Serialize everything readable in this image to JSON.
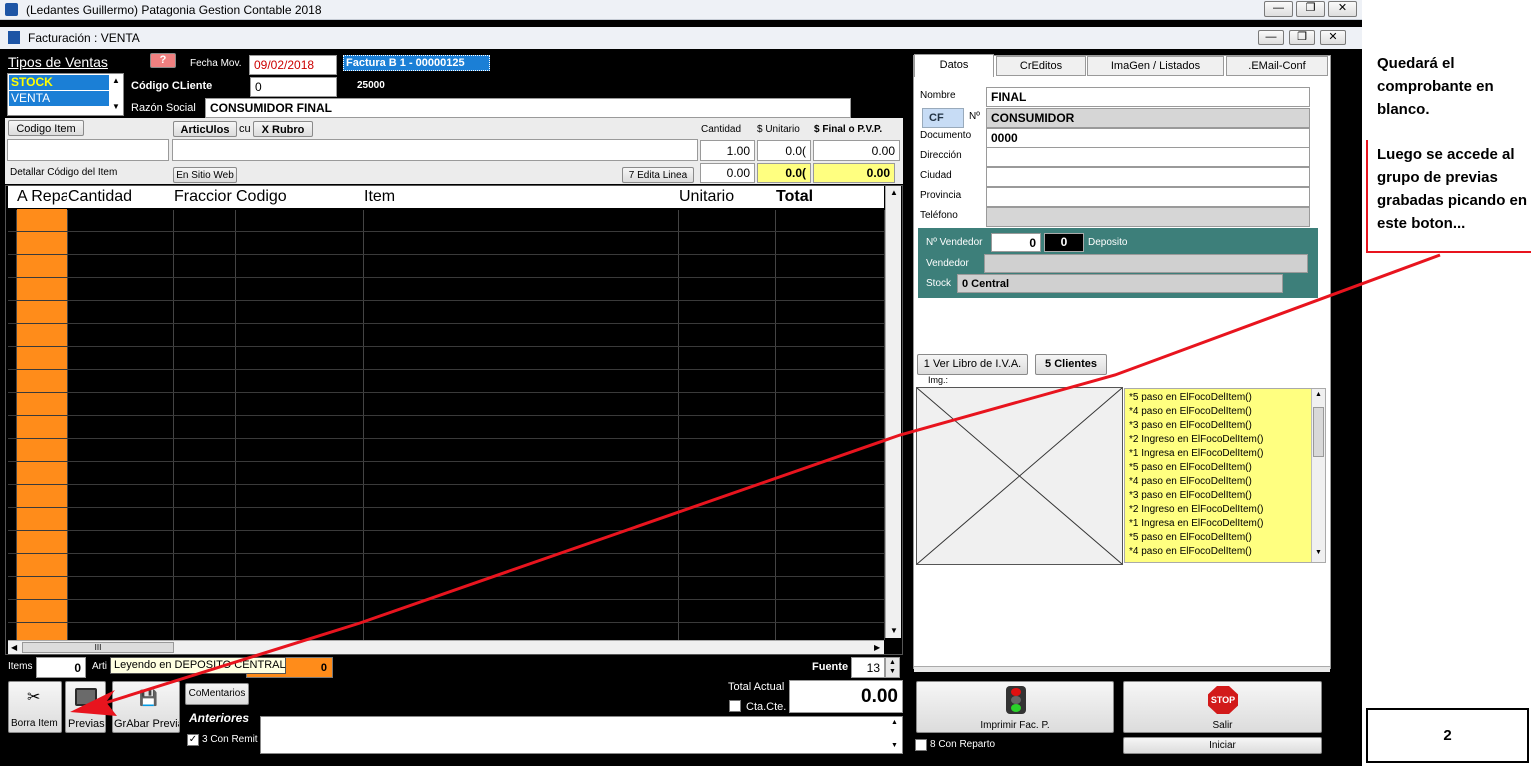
{
  "app": {
    "window_title": "(Ledantes Guillermo) Patagonia Gestion Contable 2018",
    "child_title": "Facturación : VENTA",
    "minimize_icon": "minimize-icon",
    "maximize_icon": "restore-icon",
    "close_icon": "close-icon"
  },
  "left": {
    "tipos_ventas_label": "Tipos de Ventas",
    "tipos_ventas_items": [
      "STOCK",
      "VENTA"
    ],
    "help_button": "?",
    "fecha_mov_label": "Fecha Mov.",
    "fecha_mov_value": "09/02/2018",
    "factura_label": "Factura  B   1 - 00000125",
    "codigo_cliente_label": "Código CLiente",
    "codigo_cliente_value": "0",
    "codigo_cliente_extra": "25000",
    "razon_social_label": "Razón Social",
    "razon_social_value": "CONSUMIDOR FINAL",
    "codigo_item_button": "Codigo Item",
    "articulos_button": "ArticUlos",
    "articulos_suffix": "cu",
    "rubro_button": "X Rubro",
    "cantidad_label": "Cantidad",
    "unitario_label": "$ Unitario",
    "final_label": "$ Final o P.V.P.",
    "cantidad_value": "1.00",
    "unitario_value": "0.0(",
    "final_value": "0.00",
    "detallar_label": "Detallar Código del Item",
    "en_sitio_web_button": "En Sitio Web",
    "edita_linea_button": "7 Edita Linea",
    "row2_cantidad": "0.00",
    "row2_unitario": "0.0(",
    "row2_final": "0.00"
  },
  "grid": {
    "headers": [
      "A Repa",
      "Cantidad",
      "Fraccior",
      "Codigo",
      "Item",
      "Unitario",
      "Total"
    ],
    "scroll_thumb": "III"
  },
  "bottom": {
    "items_label": "Items",
    "items_value": "0",
    "arti_label": "Arti",
    "tooltip": "Leyendo en DEPOSITO CENTRAL",
    "orange_value": "0",
    "fuente_label": "Fuente",
    "fuente_value": "13",
    "total_actual_label": "Total Actual",
    "total_actual_value": "0.00",
    "cta_cte_label": "Cta.Cte.",
    "borra_item_button": "Borra Item",
    "previas_button": "Previas",
    "grabar_previa_button": "GrAbar Previa",
    "comentarios_button": "CoMentarios",
    "anteriores_label": "Anteriores",
    "con_remito_label": "3 Con Remit"
  },
  "right": {
    "tabs": [
      "Datos",
      "CrEditos",
      "ImaGen / Listados",
      ".EMail-Conf"
    ],
    "nombre_label": "Nombre",
    "nombre_value": "FINAL",
    "cf_value": "CF",
    "nro_label": "Nº",
    "consumidor_value": "CONSUMIDOR",
    "documento_label": "Documento",
    "documento_value": "0000",
    "direccion_label": "Dirección",
    "ciudad_label": "Ciudad",
    "provincia_label": "Provincia",
    "telefono_label": "Teléfono",
    "nro_vendedor_label": "Nº Vendedor",
    "nro_vendedor_value": "0",
    "deposito_value": "0",
    "deposito_label": "Deposito",
    "vendedor_label": "Vendedor",
    "stock_label": "Stock",
    "stock_value": "0  Central",
    "ver_libro_button": "1 Ver Libro de I.V.A.",
    "clientes_button": "5 Clientes",
    "img_label": "Img.:",
    "log_lines": [
      "*5 paso en ElFocoDelItem()",
      "*4 paso en ElFocoDelItem()",
      "*3 paso en ElFocoDelItem()",
      "*2 Ingreso en ElFocoDelItem()",
      "*1 Ingresa en ElFocoDelItem()",
      "*5 paso en ElFocoDelItem()",
      "*4 paso en ElFocoDelItem()",
      "*3 paso en ElFocoDelItem()",
      "*2 Ingreso en ElFocoDelItem()",
      "*1 Ingresa en ElFocoDelItem()",
      "*5 paso en ElFocoDelItem()",
      "*4 paso en ElFocoDelItem()"
    ],
    "imprimir_button": "Imprimir Fac. P.",
    "salir_button": "Salir",
    "stop_sign": "STOP",
    "con_reparto_label": "8 Con Reparto",
    "iniciar_button": "Iniciar"
  },
  "annotation": {
    "note1": "Quedará el comprobante en blanco.",
    "note2": "Luego se accede al grupo de previas grabadas picando en este boton...",
    "page_number": "2"
  },
  "colors": {
    "orange": "#ff8c1a",
    "teal": "#3d7f7a",
    "yellow": "#ffff80",
    "selection": "#1b7fd6",
    "arrow": "#e8141e"
  }
}
